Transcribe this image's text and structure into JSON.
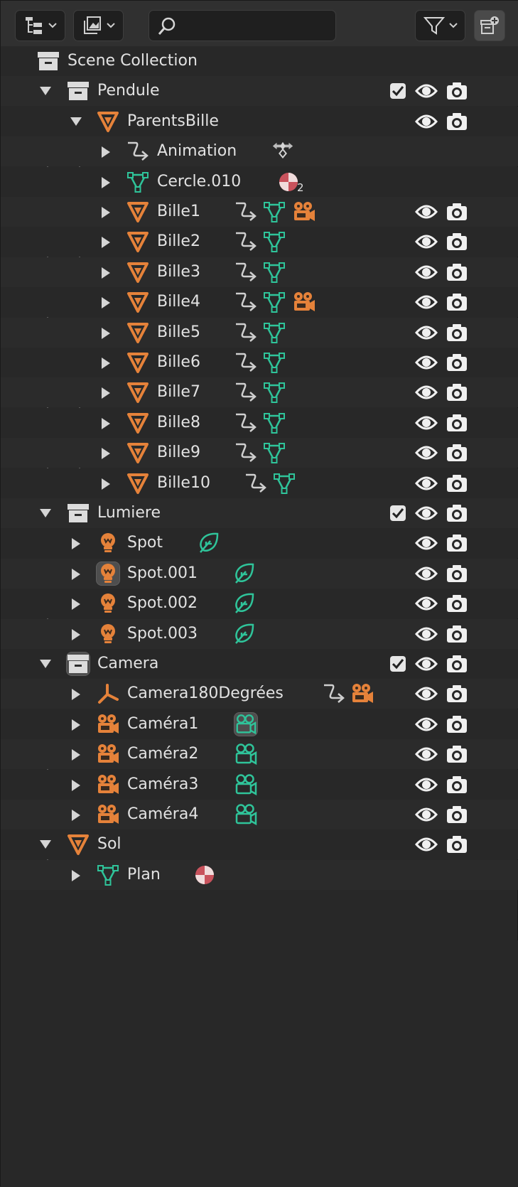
{
  "search": {
    "value": "",
    "placeholder": ""
  },
  "rows": [
    {
      "label": "Scene Collection",
      "icon": "collection-icon"
    },
    {
      "label": "Pendule",
      "icon": "collection-icon",
      "checked": true
    },
    {
      "label": "ParentsBille",
      "icon": "mesh-object-icon"
    },
    {
      "label": "Animation",
      "icon": "hierarchy-icon"
    },
    {
      "label": "Cercle.010",
      "icon": "mesh-data-icon",
      "material_count": "2"
    },
    {
      "label": "Bille1",
      "icon": "mesh-object-icon"
    },
    {
      "label": "Bille2",
      "icon": "mesh-object-icon"
    },
    {
      "label": "Bille3",
      "icon": "mesh-object-icon"
    },
    {
      "label": "Bille4",
      "icon": "mesh-object-icon"
    },
    {
      "label": "Bille5",
      "icon": "mesh-object-icon"
    },
    {
      "label": "Bille6",
      "icon": "mesh-object-icon"
    },
    {
      "label": "Bille7",
      "icon": "mesh-object-icon"
    },
    {
      "label": "Bille8",
      "icon": "mesh-object-icon"
    },
    {
      "label": "Bille9",
      "icon": "mesh-object-icon"
    },
    {
      "label": "Bille10",
      "icon": "mesh-object-icon"
    },
    {
      "label": "Lumiere",
      "icon": "collection-icon",
      "checked": true
    },
    {
      "label": "Spot",
      "icon": "light-object-icon"
    },
    {
      "label": "Spot.001",
      "icon": "light-object-icon"
    },
    {
      "label": "Spot.002",
      "icon": "light-object-icon"
    },
    {
      "label": "Spot.003",
      "icon": "light-object-icon"
    },
    {
      "label": "Camera",
      "icon": "collection-icon",
      "checked": true
    },
    {
      "label": "Camera180Degrées",
      "icon": "empty-object-icon"
    },
    {
      "label": "Caméra1",
      "icon": "camera-object-icon"
    },
    {
      "label": "Caméra2",
      "icon": "camera-object-icon"
    },
    {
      "label": "Caméra3",
      "icon": "camera-object-icon"
    },
    {
      "label": "Caméra4",
      "icon": "camera-object-icon"
    },
    {
      "label": "Sol",
      "icon": "mesh-object-icon"
    },
    {
      "label": "Plan",
      "icon": "mesh-data-icon"
    }
  ],
  "colors": {
    "object_orange": "#e5823a",
    "data_green": "#2fc49a",
    "material_red": "#c8525c",
    "text": "#e2e2e2"
  }
}
